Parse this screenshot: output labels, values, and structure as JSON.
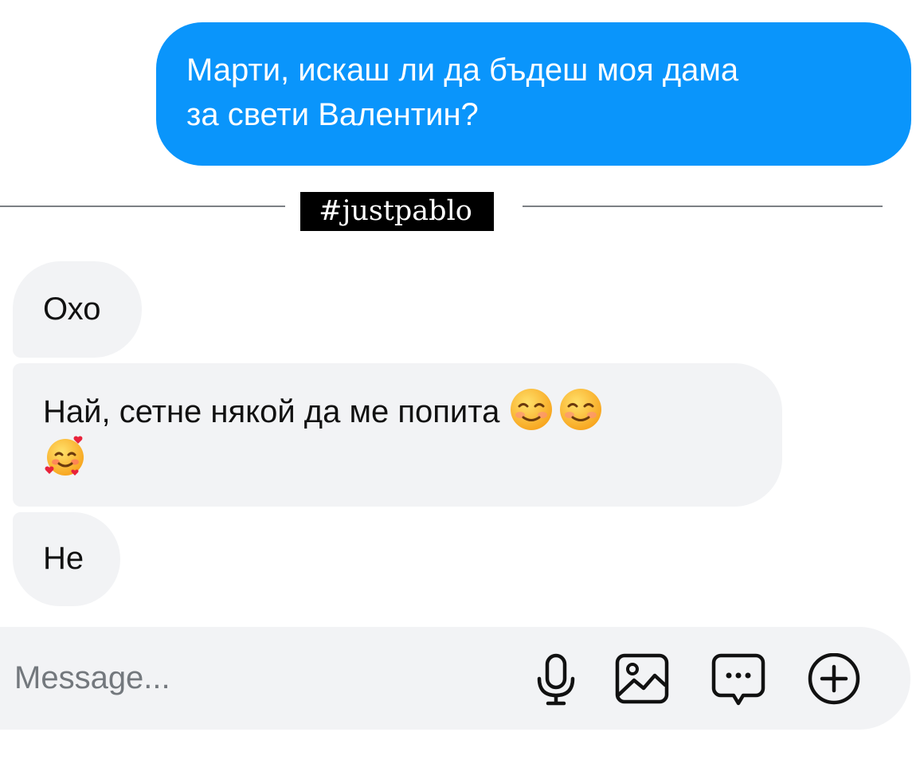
{
  "messages": {
    "outgoing": [
      {
        "line1": "Марти, искаш ли да бъдеш моя дама",
        "line2": "за свети Валентин?"
      }
    ],
    "incoming": [
      {
        "text": "Охо"
      },
      {
        "text": "Най, сетне някой да ме попита",
        "emojis": [
          "smiling-face-icon",
          "smiling-face-icon",
          "smiling-face-with-hearts-icon"
        ]
      },
      {
        "text": "Не"
      }
    ]
  },
  "divider": {
    "tag": "#justpablo"
  },
  "composer": {
    "placeholder": "Message...",
    "value": "",
    "icons": [
      "microphone-icon",
      "image-icon",
      "sticker-icon",
      "plus-icon"
    ]
  },
  "colors": {
    "outgoing_bubble": "#0a95fb",
    "incoming_bubble": "#f2f3f5",
    "divider": "#7b8084"
  }
}
